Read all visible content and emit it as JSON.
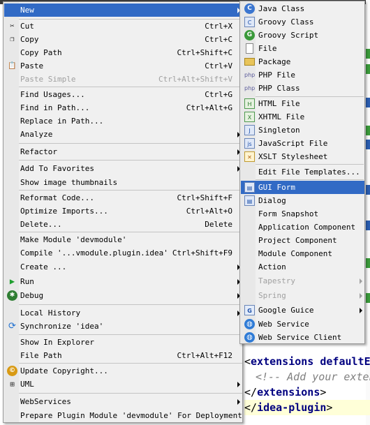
{
  "editor": {
    "lines": [
      {
        "open": "<",
        "tag": "extensions defaultEx",
        "close": "",
        "comment": ""
      },
      {
        "open": "",
        "tag": "",
        "close": "",
        "comment": "<!-- Add your extensi"
      },
      {
        "open": "</",
        "tag": "extensions",
        "close": ">",
        "comment": ""
      },
      {
        "open": "</",
        "tag": "idea-plugin",
        "close": ">",
        "comment": ""
      }
    ]
  },
  "context_menu": {
    "items": [
      {
        "label": "New",
        "shortcut": "",
        "submenu": true
      },
      {
        "label": "Cut",
        "shortcut": "Ctrl+X"
      },
      {
        "label": "Copy",
        "shortcut": "Ctrl+C"
      },
      {
        "label": "Copy Path",
        "shortcut": "Ctrl+Shift+C"
      },
      {
        "label": "Paste",
        "shortcut": "Ctrl+V"
      },
      {
        "label": "Paste Simple",
        "shortcut": "Ctrl+Alt+Shift+V"
      },
      {
        "label": "Find Usages...",
        "shortcut": "Ctrl+G"
      },
      {
        "label": "Find in Path...",
        "shortcut": "Ctrl+Alt+G"
      },
      {
        "label": "Replace in Path...",
        "shortcut": ""
      },
      {
        "label": "Analyze",
        "shortcut": "",
        "submenu": true
      },
      {
        "label": "Refactor",
        "shortcut": "",
        "submenu": true
      },
      {
        "label": "Add To Favorites",
        "shortcut": "",
        "submenu": true
      },
      {
        "label": "Show image thumbnails",
        "shortcut": ""
      },
      {
        "label": "Reformat Code...",
        "shortcut": "Ctrl+Shift+F"
      },
      {
        "label": "Optimize Imports...",
        "shortcut": "Ctrl+Alt+O"
      },
      {
        "label": "Delete...",
        "shortcut": "Delete"
      },
      {
        "label": "Make Module 'devmodule'",
        "shortcut": ""
      },
      {
        "label": "Compile '...vmodule.plugin.idea'",
        "shortcut": "Ctrl+Shift+F9"
      },
      {
        "label": "Create ...",
        "shortcut": "",
        "submenu": true
      },
      {
        "label": "Run",
        "shortcut": "",
        "submenu": true
      },
      {
        "label": "Debug",
        "shortcut": "",
        "submenu": true
      },
      {
        "label": "Local History",
        "shortcut": "",
        "submenu": true
      },
      {
        "label": "Synchronize 'idea'",
        "shortcut": ""
      },
      {
        "label": "Show In Explorer",
        "shortcut": ""
      },
      {
        "label": "File Path",
        "shortcut": "Ctrl+Alt+F12"
      },
      {
        "label": "Update Copyright...",
        "shortcut": ""
      },
      {
        "label": "UML",
        "shortcut": "",
        "submenu": true
      },
      {
        "label": "WebServices",
        "shortcut": "",
        "submenu": true
      },
      {
        "label": "Prepare Plugin Module 'devmodule' For Deployment",
        "shortcut": ""
      }
    ]
  },
  "new_submenu": {
    "items": [
      {
        "label": "Java Class",
        "icon": "java-class-icon"
      },
      {
        "label": "Groovy Class",
        "icon": "groovy-class-icon"
      },
      {
        "label": "Groovy Script",
        "icon": "groovy-script-icon"
      },
      {
        "label": "File",
        "icon": "file-icon"
      },
      {
        "label": "Package",
        "icon": "package-icon"
      },
      {
        "label": "PHP File",
        "icon": "php-file-icon"
      },
      {
        "label": "PHP Class",
        "icon": "php-class-icon"
      },
      {
        "label": "HTML File",
        "icon": "html-file-icon"
      },
      {
        "label": "XHTML File",
        "icon": "xhtml-file-icon"
      },
      {
        "label": "Singleton",
        "icon": "singleton-icon"
      },
      {
        "label": "JavaScript File",
        "icon": "javascript-file-icon"
      },
      {
        "label": "XSLT Stylesheet",
        "icon": "xslt-icon"
      },
      {
        "label": "Edit File Templates...",
        "icon": ""
      },
      {
        "label": "GUI Form",
        "icon": "gui-form-icon"
      },
      {
        "label": "Dialog",
        "icon": "dialog-icon"
      },
      {
        "label": "Form Snapshot",
        "icon": ""
      },
      {
        "label": "Application Component",
        "icon": ""
      },
      {
        "label": "Project Component",
        "icon": ""
      },
      {
        "label": "Module Component",
        "icon": ""
      },
      {
        "label": "Action",
        "icon": ""
      },
      {
        "label": "Tapestry",
        "icon": ""
      },
      {
        "label": "Spring",
        "icon": ""
      },
      {
        "label": "Google Guice",
        "icon": "google-guice-icon"
      },
      {
        "label": "Web Service",
        "icon": "web-service-icon"
      },
      {
        "label": "Web Service Client",
        "icon": "web-service-client-icon"
      }
    ]
  },
  "colors": {
    "menu_background": "#f0f0f0",
    "selection": "#316ac5",
    "disabled_text": "#a0a0a0",
    "xml_tag": "#000080"
  }
}
